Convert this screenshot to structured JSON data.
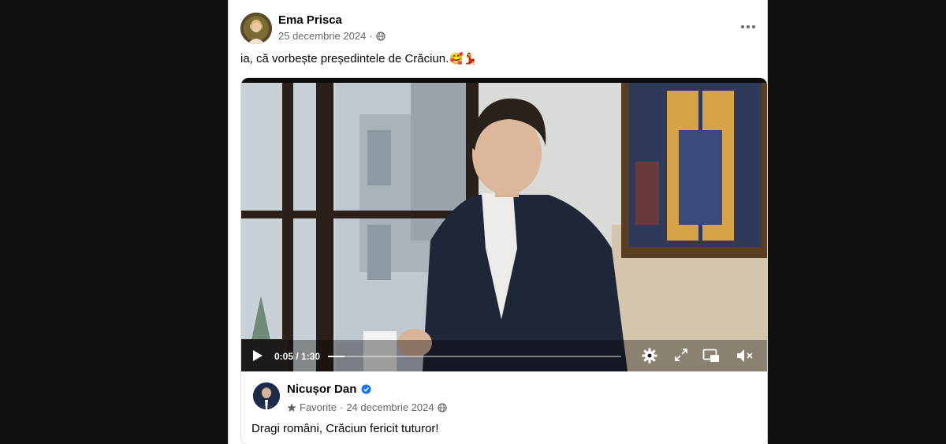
{
  "post": {
    "author": "Ema Prisca",
    "date": "25 decembrie 2024",
    "separator": "·",
    "caption": "ia, că vorbește președintele de Crăciun.",
    "caption_emojis": "🥰💃"
  },
  "shared_post": {
    "author": "Nicușor Dan",
    "favorite_label": "Favorite",
    "separator": "·",
    "date": "24 decembrie 2024",
    "text": "Dragi români, Crăciun fericit tuturor!"
  },
  "video": {
    "time_display": "0:05 / 1:30",
    "progress_fraction": 0.056
  },
  "colors": {
    "background": "#111111",
    "card": "#ffffff",
    "secondary_text": "#65676b",
    "verified_blue": "#1877f2"
  }
}
